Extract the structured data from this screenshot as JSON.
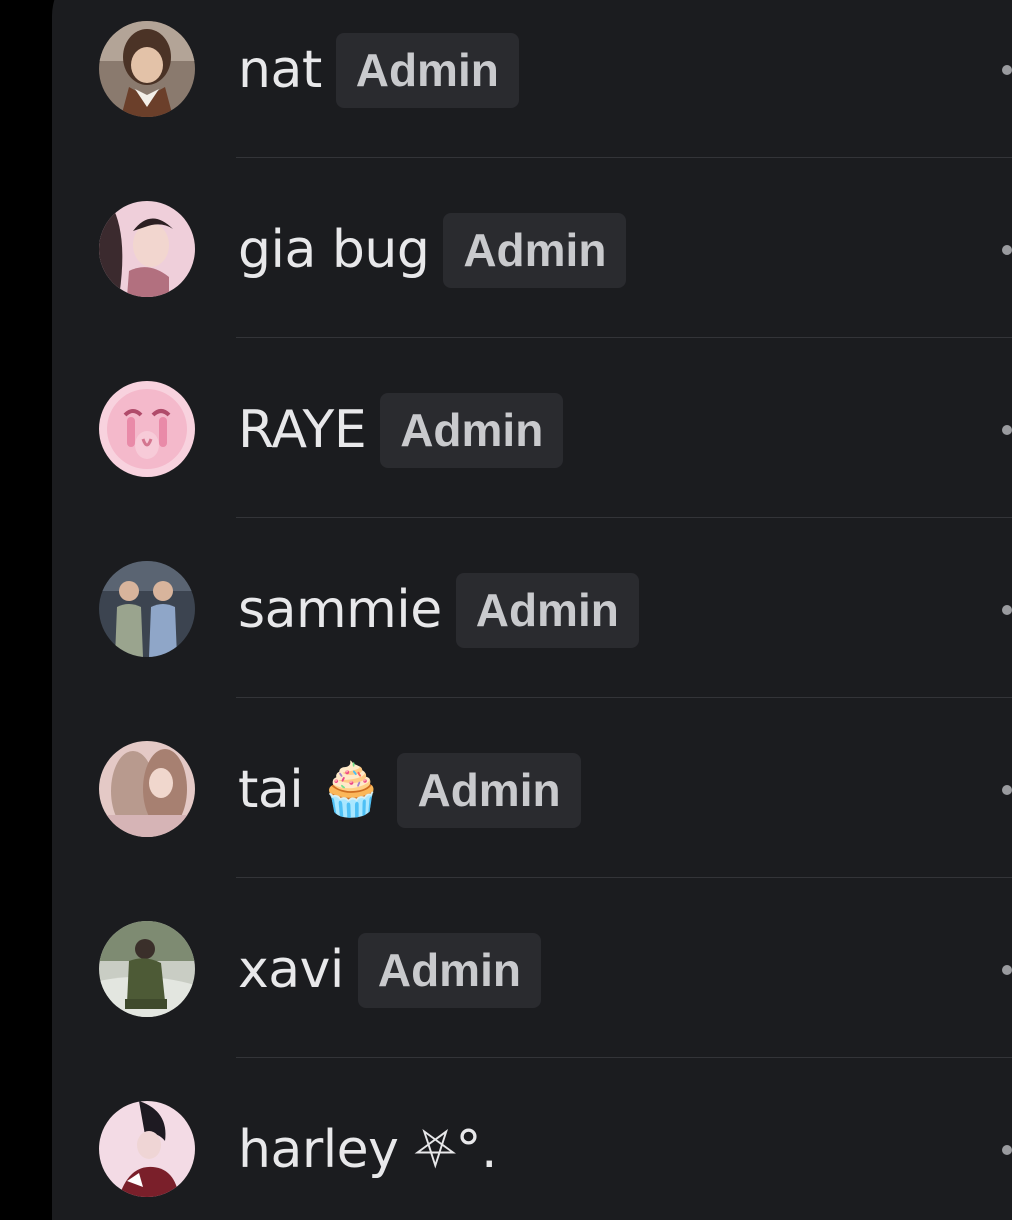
{
  "members": [
    {
      "name": "nat",
      "role": "Admin",
      "avatar": "avatar-nat",
      "avatar_color": "#6d5a4e"
    },
    {
      "name": "gia bug",
      "role": "Admin",
      "avatar": "avatar-gia-bug",
      "avatar_color": "#e6b9c7"
    },
    {
      "name": "RAYE",
      "role": "Admin",
      "avatar": "avatar-raye",
      "avatar_color": "#f5c8d6"
    },
    {
      "name": "sammie",
      "role": "Admin",
      "avatar": "avatar-sammie",
      "avatar_color": "#8c98a4"
    },
    {
      "name": "tai 🧁",
      "role": "Admin",
      "avatar": "avatar-tai",
      "avatar_color": "#d9b9b9"
    },
    {
      "name": "xavi",
      "role": "Admin",
      "avatar": "avatar-xavi",
      "avatar_color": "#5d6a4c"
    },
    {
      "name": "harley ⛧°.",
      "role": "",
      "avatar": "avatar-harley",
      "avatar_color": "#e9c6d8"
    }
  ],
  "colors": {
    "background": "#000000",
    "panel": "#1b1c1f",
    "badge_bg": "#2a2b2f",
    "badge_text": "#c9cacd",
    "name_text": "#e8e8ea",
    "divider": "#333438",
    "more_dot": "#9a9b9f"
  },
  "icons": {
    "more": "more-options-icon"
  }
}
